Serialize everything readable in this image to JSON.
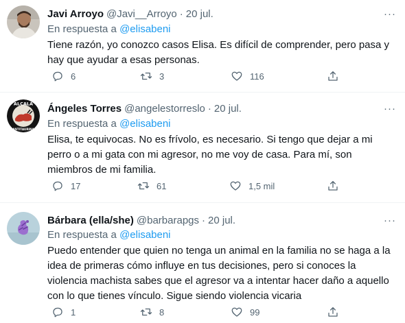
{
  "reply_prefix": "En respuesta a",
  "dot": "·",
  "more": "···",
  "colors": {
    "text": "#0f1419",
    "muted": "#536471",
    "link": "#1d9bf0",
    "border": "#eff3f4"
  },
  "tweets": [
    {
      "name": "Javi Arroyo",
      "handle": "@Javi__Arroyo",
      "date": "20 jul.",
      "reply_to": "@elisabeni",
      "text": "Tiene razón, yo conozco casos Elisa. Es difícil de comprender, pero pasa y hay que ayudar a esas personas.",
      "replies": "6",
      "retweets": "3",
      "likes": "116"
    },
    {
      "name": "Ángeles Torres",
      "handle": "@angelestorreslo",
      "date": "20 jul.",
      "reply_to": "@elisabeni",
      "avatar_text_top": "ALCALÁ",
      "avatar_text_bottom": "ANTITAURINA",
      "text": "Elisa, te equivocas. No es frívolo, es necesario. Si tengo que dejar a mi perro o a mi gata con mi agresor, no me voy de casa. Para mí, son miembros de mi familia.",
      "replies": "17",
      "retweets": "61",
      "likes": "1,5 mil"
    },
    {
      "name": "Bárbara (ella/she)",
      "handle": "@barbarapgs",
      "date": "20 jul.",
      "reply_to": "@elisabeni",
      "text": "Puedo entender que quien no tenga un animal en la familia no se haga a la idea de primeras cómo influye en tus decisiones, pero si conoces la violencia machista sabes que el agresor va a intentar hacer daño a aquello con lo que tienes vínculo. Sigue siendo violencia vicaria",
      "replies": "1",
      "retweets": "8",
      "likes": "99"
    }
  ]
}
